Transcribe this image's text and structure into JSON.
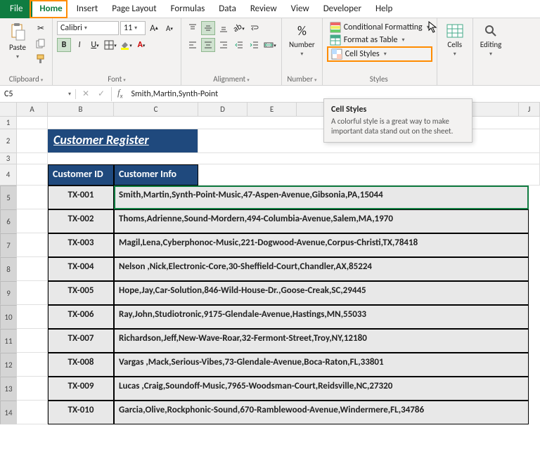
{
  "tabs": {
    "file": "File",
    "home": "Home",
    "insert": "Insert",
    "pageLayout": "Page Layout",
    "formulas": "Formulas",
    "data": "Data",
    "review": "Review",
    "view": "View",
    "developer": "Developer",
    "help": "Help"
  },
  "ribbon": {
    "clipboard": {
      "paste": "Paste",
      "label": "Clipboard"
    },
    "font": {
      "name": "Calibri",
      "size": "11",
      "label": "Font"
    },
    "alignment": {
      "label": "Alignment"
    },
    "number": {
      "label": "Number",
      "btn": "Number"
    },
    "styles": {
      "label": "Styles",
      "cond": "Conditional Formatting",
      "table": "Format as Table",
      "cell": "Cell Styles"
    },
    "cells": {
      "label": "Cells",
      "btn": "Cells"
    },
    "editing": {
      "label": "Editing",
      "btn": "Editing"
    }
  },
  "tooltip": {
    "title": "Cell Styles",
    "body": "A colorful style is a great way to make important data stand out on the sheet."
  },
  "nameBox": "C5",
  "formula": "Smith,Martin,Synth-Point",
  "columns": {
    "A": "A",
    "B": "B",
    "C": "C",
    "D": "D",
    "E": "E",
    "J": "J"
  },
  "rows": [
    1,
    2,
    3,
    4,
    5,
    6,
    7,
    8,
    9,
    10,
    11,
    12,
    13,
    14
  ],
  "title": "Customer Register",
  "headers": {
    "id": "Customer ID",
    "info": "Customer Info"
  },
  "data": [
    {
      "id": "TX-001",
      "info": "Smith,Martin,Synth-Point-Music,47-Aspen-Avenue,Gibsonia,PA,15044"
    },
    {
      "id": "TX-002",
      "info": "Thoms,Adrienne,Sound-Mordern,494-Columbia-Avenue,Salem,MA,1970"
    },
    {
      "id": "TX-003",
      "info": "Magil,Lena,Cyberphonoc-Music,221-Dogwood-Avenue,Corpus-Christi,TX,78418"
    },
    {
      "id": "TX-004",
      "info": "Nelson ,Nick,Electronic-Core,30-Sheffield-Court,Chandler,AX,85224"
    },
    {
      "id": "TX-005",
      "info": "Hope,Jay,Car-Solution,846-Wild-House-Dr.,Goose-Creak,SC,29445"
    },
    {
      "id": "TX-006",
      "info": "Ray,John,Studiotronic,9175-Glendale-Avenue,Hastings,MN,55033"
    },
    {
      "id": "TX-007",
      "info": "Richardson,Jeff,New-Wave-Roar,32-Fermont-Street,Troy,NY,12180"
    },
    {
      "id": "TX-008",
      "info": "Vargas ,Mack,Serious-Vibes,73-Glendale-Avenue,Boca-Raton,FL,33801"
    },
    {
      "id": "TX-009",
      "info": "Lucas ,Craig,Soundoff-Music,7965-Woodsman-Court,Reidsville,NC,27320"
    },
    {
      "id": "TX-010",
      "info": "Garcia,Olive,Rockphonic-Sound,670-Ramblewood-Avenue,Windermere,FL,34786"
    }
  ],
  "chart_data": {
    "type": "table",
    "title": "Customer Register",
    "columns": [
      "Customer ID",
      "Customer Info"
    ],
    "rows": [
      [
        "TX-001",
        "Smith,Martin,Synth-Point-Music,47-Aspen-Avenue,Gibsonia,PA,15044"
      ],
      [
        "TX-002",
        "Thoms,Adrienne,Sound-Mordern,494-Columbia-Avenue,Salem,MA,1970"
      ],
      [
        "TX-003",
        "Magil,Lena,Cyberphonoc-Music,221-Dogwood-Avenue,Corpus-Christi,TX,78418"
      ],
      [
        "TX-004",
        "Nelson ,Nick,Electronic-Core,30-Sheffield-Court,Chandler,AX,85224"
      ],
      [
        "TX-005",
        "Hope,Jay,Car-Solution,846-Wild-House-Dr.,Goose-Creak,SC,29445"
      ],
      [
        "TX-006",
        "Ray,John,Studiotronic,9175-Glendale-Avenue,Hastings,MN,55033"
      ],
      [
        "TX-007",
        "Richardson,Jeff,New-Wave-Roar,32-Fermont-Street,Troy,NY,12180"
      ],
      [
        "TX-008",
        "Vargas ,Mack,Serious-Vibes,73-Glendale-Avenue,Boca-Raton,FL,33801"
      ],
      [
        "TX-009",
        "Lucas ,Craig,Soundoff-Music,7965-Woodsman-Court,Reidsville,NC,27320"
      ],
      [
        "TX-010",
        "Garcia,Olive,Rockphonic-Sound,670-Ramblewood-Avenue,Windermere,FL,34786"
      ]
    ]
  }
}
